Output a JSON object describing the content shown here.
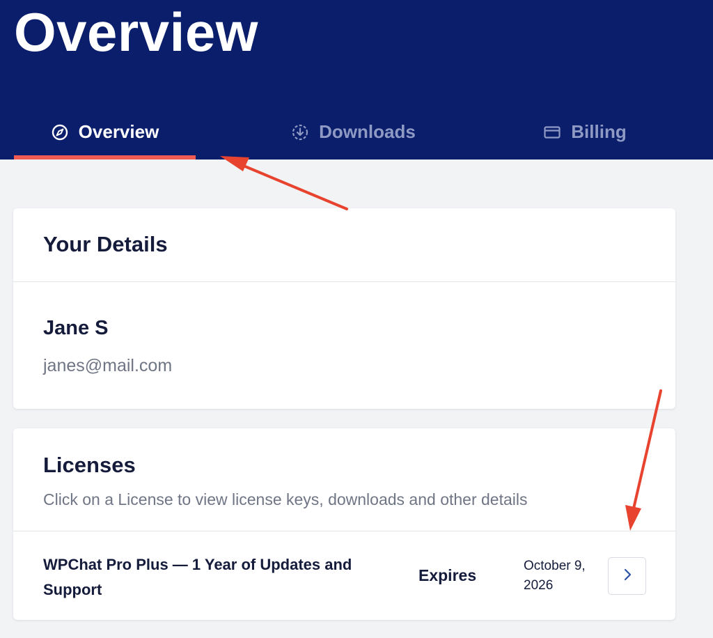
{
  "header": {
    "title": "Overview",
    "tabs": [
      {
        "label": "Overview",
        "icon": "compass-icon",
        "active": true
      },
      {
        "label": "Downloads",
        "icon": "download-circle-icon",
        "active": false
      },
      {
        "label": "Billing",
        "icon": "credit-card-icon",
        "active": false
      }
    ]
  },
  "details": {
    "title": "Your Details",
    "name": "Jane S",
    "email": "janes@mail.com"
  },
  "licenses": {
    "title": "Licenses",
    "subtitle": "Click on a License to view license keys, downloads and other details",
    "items": [
      {
        "name": "WPChat Pro Plus — 1 Year of Updates and Support",
        "expires_label": "Expires",
        "expires_date": "October 9, 2026"
      }
    ]
  },
  "colors": {
    "header_bg": "#0a1e6b",
    "active_tab_underline": "#ef5b52",
    "muted_tab_text": "#8f9ac4",
    "page_bg": "#f2f3f5",
    "annotation_arrow": "#e8432e"
  }
}
